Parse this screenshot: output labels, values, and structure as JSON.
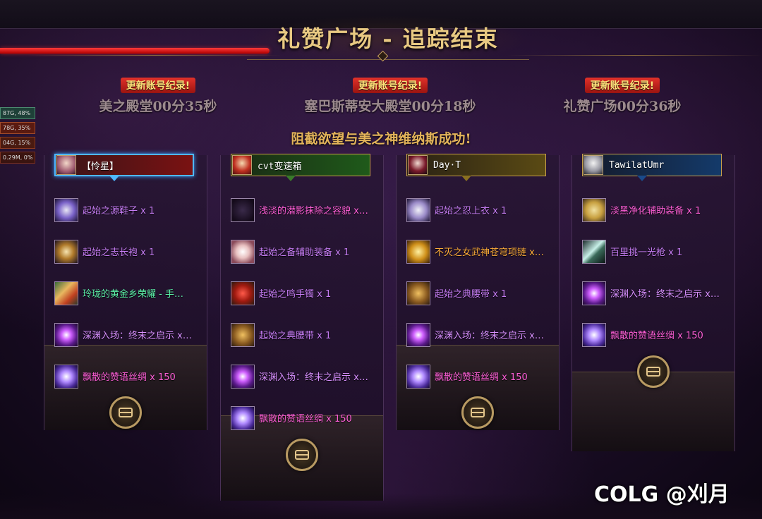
{
  "title": "礼赞广场 - 追踪结束",
  "records": [
    {
      "badge": "更新账号纪录!",
      "text": "美之殿堂00分35秒"
    },
    {
      "badge": "更新账号纪录!",
      "text": "塞巴斯蒂安大殿堂00分18秒"
    },
    {
      "badge": "更新账号纪录!",
      "text": "礼赞广场00分36秒"
    }
  ],
  "success_message": "阻截欲望与美之神维纳斯成功!",
  "side_stats": [
    "87G, 48%",
    "78G, 35%",
    "04G, 15%",
    "0.29M, 0%"
  ],
  "columns": [
    {
      "player": "【怜星】",
      "selected": true,
      "items": [
        {
          "icon": "shoe-icon",
          "label": "起始之源鞋子 x 1",
          "quality": "epic"
        },
        {
          "icon": "robe-icon",
          "label": "起始之志长袍 x 1",
          "quality": "epic"
        },
        {
          "icon": "gold-emblem-icon",
          "label": "玲珑的黄金乡荣耀 - 手…",
          "quality": "green"
        },
        {
          "icon": "abyss-orb-icon",
          "label": "深渊入场：终末之启示 x…",
          "quality": "purple"
        },
        {
          "icon": "silk-icon",
          "label": "飘散的赞语丝绸 x 150",
          "quality": "pink"
        }
      ]
    },
    {
      "player": "cvt变速箱",
      "selected": false,
      "items": [
        {
          "icon": "mask-icon",
          "label": "浅淡的潜影抹除之容貌 x…",
          "quality": "pink"
        },
        {
          "icon": "aux-equip-icon",
          "label": "起始之备辅助装备 x 1",
          "quality": "epic"
        },
        {
          "icon": "bracelet-icon",
          "label": "起始之鸣手镯 x 1",
          "quality": "epic"
        },
        {
          "icon": "belt-icon",
          "label": "起始之典腰带 x 1",
          "quality": "epic"
        },
        {
          "icon": "abyss-orb-icon",
          "label": "深渊入场：终末之启示 x…",
          "quality": "purple"
        },
        {
          "icon": "silk-icon",
          "label": "飘散的赞语丝绸 x 150",
          "quality": "pink"
        }
      ]
    },
    {
      "player": "Day·T",
      "selected": false,
      "items": [
        {
          "icon": "coat-icon",
          "label": "起始之忍上衣 x 1",
          "quality": "epic"
        },
        {
          "icon": "necklace-icon",
          "label": "不灭之女武神苍穹项链 x…",
          "quality": "orange"
        },
        {
          "icon": "belt-icon",
          "label": "起始之典腰带 x 1",
          "quality": "epic"
        },
        {
          "icon": "abyss-orb-icon",
          "label": "深渊入场：终末之启示 x…",
          "quality": "purple"
        },
        {
          "icon": "silk-icon",
          "label": "飘散的赞语丝绸 x 150",
          "quality": "pink"
        }
      ]
    },
    {
      "player": "TawilatUmr",
      "selected": false,
      "items": [
        {
          "icon": "hoop-icon",
          "label": "淡黑净化辅助装备 x 1",
          "quality": "pink"
        },
        {
          "icon": "spear-icon",
          "label": "百里挑一光枪 x 1",
          "quality": "epic"
        },
        {
          "icon": "abyss-orb-icon",
          "label": "深渊入场：终末之启示 x…",
          "quality": "purple"
        },
        {
          "icon": "silk-icon",
          "label": "飘散的赞语丝绸 x 150",
          "quality": "pink"
        }
      ]
    }
  ],
  "watermark": "COLG @刈月"
}
